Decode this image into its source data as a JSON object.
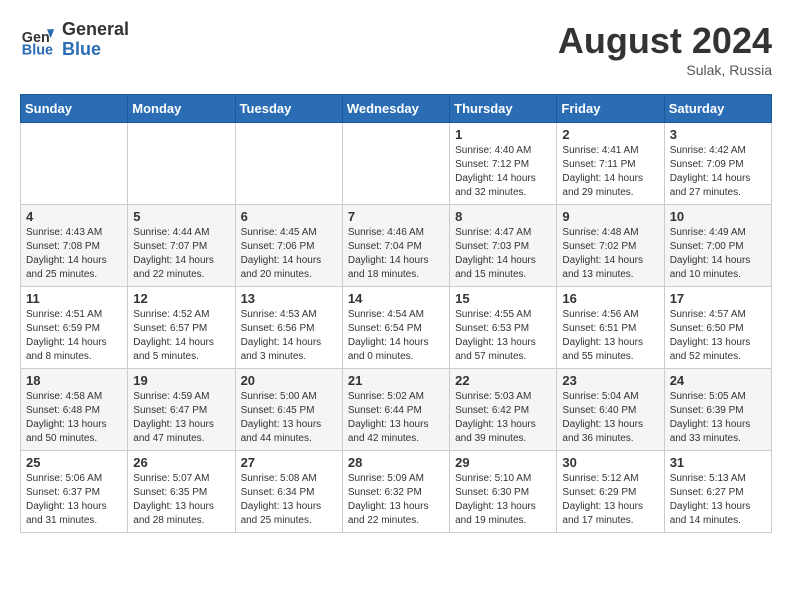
{
  "header": {
    "logo_general": "General",
    "logo_blue": "Blue",
    "month_year": "August 2024",
    "location": "Sulak, Russia"
  },
  "days_of_week": [
    "Sunday",
    "Monday",
    "Tuesday",
    "Wednesday",
    "Thursday",
    "Friday",
    "Saturday"
  ],
  "weeks": [
    [
      {
        "day": "",
        "info": ""
      },
      {
        "day": "",
        "info": ""
      },
      {
        "day": "",
        "info": ""
      },
      {
        "day": "",
        "info": ""
      },
      {
        "day": "1",
        "info": "Sunrise: 4:40 AM\nSunset: 7:12 PM\nDaylight: 14 hours\nand 32 minutes."
      },
      {
        "day": "2",
        "info": "Sunrise: 4:41 AM\nSunset: 7:11 PM\nDaylight: 14 hours\nand 29 minutes."
      },
      {
        "day": "3",
        "info": "Sunrise: 4:42 AM\nSunset: 7:09 PM\nDaylight: 14 hours\nand 27 minutes."
      }
    ],
    [
      {
        "day": "4",
        "info": "Sunrise: 4:43 AM\nSunset: 7:08 PM\nDaylight: 14 hours\nand 25 minutes."
      },
      {
        "day": "5",
        "info": "Sunrise: 4:44 AM\nSunset: 7:07 PM\nDaylight: 14 hours\nand 22 minutes."
      },
      {
        "day": "6",
        "info": "Sunrise: 4:45 AM\nSunset: 7:06 PM\nDaylight: 14 hours\nand 20 minutes."
      },
      {
        "day": "7",
        "info": "Sunrise: 4:46 AM\nSunset: 7:04 PM\nDaylight: 14 hours\nand 18 minutes."
      },
      {
        "day": "8",
        "info": "Sunrise: 4:47 AM\nSunset: 7:03 PM\nDaylight: 14 hours\nand 15 minutes."
      },
      {
        "day": "9",
        "info": "Sunrise: 4:48 AM\nSunset: 7:02 PM\nDaylight: 14 hours\nand 13 minutes."
      },
      {
        "day": "10",
        "info": "Sunrise: 4:49 AM\nSunset: 7:00 PM\nDaylight: 14 hours\nand 10 minutes."
      }
    ],
    [
      {
        "day": "11",
        "info": "Sunrise: 4:51 AM\nSunset: 6:59 PM\nDaylight: 14 hours\nand 8 minutes."
      },
      {
        "day": "12",
        "info": "Sunrise: 4:52 AM\nSunset: 6:57 PM\nDaylight: 14 hours\nand 5 minutes."
      },
      {
        "day": "13",
        "info": "Sunrise: 4:53 AM\nSunset: 6:56 PM\nDaylight: 14 hours\nand 3 minutes."
      },
      {
        "day": "14",
        "info": "Sunrise: 4:54 AM\nSunset: 6:54 PM\nDaylight: 14 hours\nand 0 minutes."
      },
      {
        "day": "15",
        "info": "Sunrise: 4:55 AM\nSunset: 6:53 PM\nDaylight: 13 hours\nand 57 minutes."
      },
      {
        "day": "16",
        "info": "Sunrise: 4:56 AM\nSunset: 6:51 PM\nDaylight: 13 hours\nand 55 minutes."
      },
      {
        "day": "17",
        "info": "Sunrise: 4:57 AM\nSunset: 6:50 PM\nDaylight: 13 hours\nand 52 minutes."
      }
    ],
    [
      {
        "day": "18",
        "info": "Sunrise: 4:58 AM\nSunset: 6:48 PM\nDaylight: 13 hours\nand 50 minutes."
      },
      {
        "day": "19",
        "info": "Sunrise: 4:59 AM\nSunset: 6:47 PM\nDaylight: 13 hours\nand 47 minutes."
      },
      {
        "day": "20",
        "info": "Sunrise: 5:00 AM\nSunset: 6:45 PM\nDaylight: 13 hours\nand 44 minutes."
      },
      {
        "day": "21",
        "info": "Sunrise: 5:02 AM\nSunset: 6:44 PM\nDaylight: 13 hours\nand 42 minutes."
      },
      {
        "day": "22",
        "info": "Sunrise: 5:03 AM\nSunset: 6:42 PM\nDaylight: 13 hours\nand 39 minutes."
      },
      {
        "day": "23",
        "info": "Sunrise: 5:04 AM\nSunset: 6:40 PM\nDaylight: 13 hours\nand 36 minutes."
      },
      {
        "day": "24",
        "info": "Sunrise: 5:05 AM\nSunset: 6:39 PM\nDaylight: 13 hours\nand 33 minutes."
      }
    ],
    [
      {
        "day": "25",
        "info": "Sunrise: 5:06 AM\nSunset: 6:37 PM\nDaylight: 13 hours\nand 31 minutes."
      },
      {
        "day": "26",
        "info": "Sunrise: 5:07 AM\nSunset: 6:35 PM\nDaylight: 13 hours\nand 28 minutes."
      },
      {
        "day": "27",
        "info": "Sunrise: 5:08 AM\nSunset: 6:34 PM\nDaylight: 13 hours\nand 25 minutes."
      },
      {
        "day": "28",
        "info": "Sunrise: 5:09 AM\nSunset: 6:32 PM\nDaylight: 13 hours\nand 22 minutes."
      },
      {
        "day": "29",
        "info": "Sunrise: 5:10 AM\nSunset: 6:30 PM\nDaylight: 13 hours\nand 19 minutes."
      },
      {
        "day": "30",
        "info": "Sunrise: 5:12 AM\nSunset: 6:29 PM\nDaylight: 13 hours\nand 17 minutes."
      },
      {
        "day": "31",
        "info": "Sunrise: 5:13 AM\nSunset: 6:27 PM\nDaylight: 13 hours\nand 14 minutes."
      }
    ]
  ]
}
